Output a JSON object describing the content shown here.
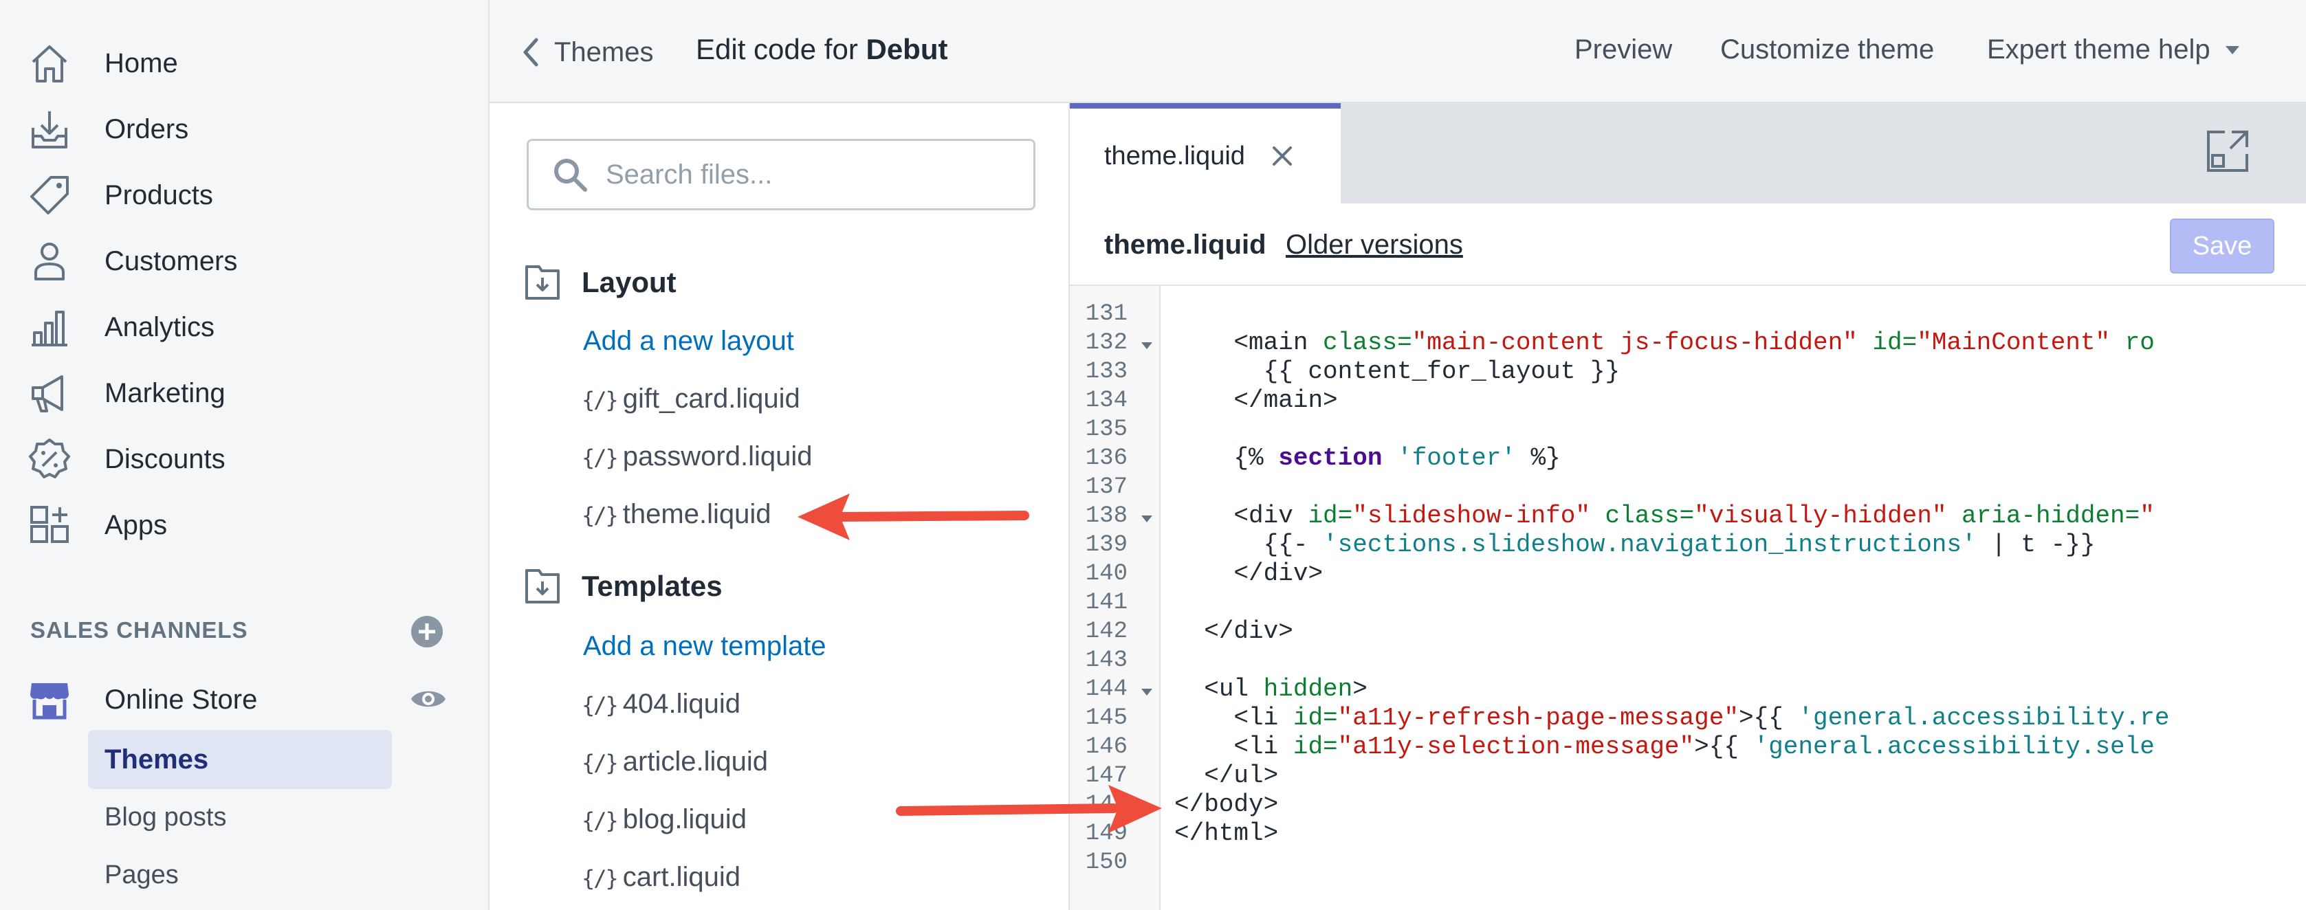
{
  "sidebar": {
    "nav": [
      {
        "label": "Home",
        "icon": "home-icon"
      },
      {
        "label": "Orders",
        "icon": "orders-icon"
      },
      {
        "label": "Products",
        "icon": "tag-icon"
      },
      {
        "label": "Customers",
        "icon": "person-icon"
      },
      {
        "label": "Analytics",
        "icon": "bar-chart-icon"
      },
      {
        "label": "Marketing",
        "icon": "megaphone-icon"
      },
      {
        "label": "Discounts",
        "icon": "discount-icon"
      },
      {
        "label": "Apps",
        "icon": "apps-icon"
      }
    ],
    "sales_channels_heading": "SALES CHANNELS",
    "online_store": "Online Store",
    "sub_items": [
      "Themes",
      "Blog posts",
      "Pages"
    ]
  },
  "topbar": {
    "back_label": "Themes",
    "edit_prefix": "Edit code for",
    "theme_name": "Debut",
    "preview": "Preview",
    "customize": "Customize theme",
    "expert_help": "Expert theme help"
  },
  "filetree": {
    "search_placeholder": "Search files...",
    "layout_heading": "Layout",
    "add_layout": "Add a new layout",
    "layout_files": [
      "gift_card.liquid",
      "password.liquid",
      "theme.liquid"
    ],
    "templates_heading": "Templates",
    "add_template": "Add a new template",
    "template_files": [
      "404.liquid",
      "article.liquid",
      "blog.liquid",
      "cart.liquid"
    ],
    "file_glyph": "{/}"
  },
  "editor": {
    "tab_name": "theme.liquid",
    "file_name": "theme.liquid",
    "older_versions": "Older versions",
    "save_label": "Save",
    "line_numbers": [
      "131",
      "132",
      "133",
      "134",
      "135",
      "136",
      "137",
      "138",
      "139",
      "140",
      "141",
      "142",
      "143",
      "144",
      "145",
      "146",
      "147",
      "148",
      "149",
      "150"
    ],
    "code": {
      "l132": [
        "<main ",
        "class=",
        "\"main-content js-focus-hidden\"",
        " id=",
        "\"MainContent\"",
        " ro"
      ],
      "l133": "{{ content_for_layout }}",
      "l134": "</main>",
      "l136": [
        "{% ",
        "section",
        " 'footer'",
        " %}"
      ],
      "l138": [
        "<div ",
        "id=",
        "\"slideshow-info\"",
        " class=",
        "\"visually-hidden\"",
        " aria-hidden=",
        "\""
      ],
      "l139": [
        "{{- ",
        "'sections.slideshow.navigation_instructions'",
        " | t -}}"
      ],
      "l140": "</div>",
      "l142": "</div>",
      "l144": [
        "<ul ",
        "hidden",
        ">"
      ],
      "l145": [
        "<li ",
        "id=",
        "\"a11y-refresh-page-message\"",
        ">{{ ",
        "'general.accessibility.re"
      ],
      "l146": [
        "<li ",
        "id=",
        "\"a11y-selection-message\"",
        ">{{ ",
        "'general.accessibility.sele"
      ],
      "l147": "</ul>",
      "l148": "</body>",
      "l149": "</html>"
    }
  },
  "colors": {
    "accent": "#5c6ac4",
    "link": "#006fbb",
    "annotation_arrow": "#ef4d3c",
    "save_disabled": "#b3bcf5"
  }
}
